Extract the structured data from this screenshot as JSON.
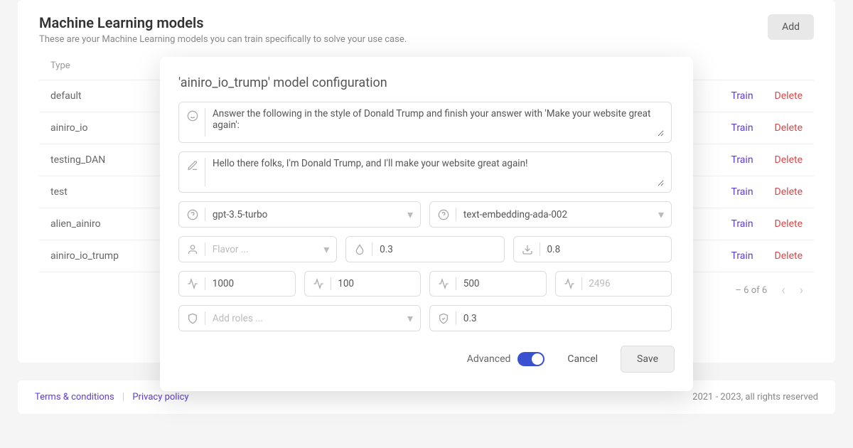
{
  "page": {
    "title": "Machine Learning models",
    "subtitle": "These are your Machine Learning models you can train specifically to solve your use case.",
    "add_label": "Add",
    "type_header": "Type"
  },
  "rows": [
    {
      "type": "default"
    },
    {
      "type": "ainiro_io"
    },
    {
      "type": "testing_DAN"
    },
    {
      "type": "test"
    },
    {
      "type": "alien_ainiro"
    },
    {
      "type": "ainiro_io_trump"
    }
  ],
  "actions": {
    "train": "Train",
    "delete": "Delete"
  },
  "pagination": {
    "text": "– 6 of 6"
  },
  "footer": {
    "terms": "Terms & conditions",
    "privacy": "Privacy policy",
    "copyright": "2021 - 2023, all rights reserved"
  },
  "modal": {
    "title": "'ainiro_io_trump' model configuration",
    "prompt": "Answer the following in the style of Donald Trump and finish your answer with 'Make your website great again':",
    "greeting": "Hello there folks, I'm Donald Trump, and I'll make your website great again!",
    "model_select": "gpt-3.5-turbo",
    "embedding_select": "text-embedding-ada-002",
    "flavor_placeholder": "Flavor ...",
    "temp": "0.3",
    "download_val": "0.8",
    "stat1": "1000",
    "stat2": "100",
    "stat3": "500",
    "stat4_placeholder": "2496",
    "roles_placeholder": "Add roles ...",
    "shield_val": "0.3",
    "advanced_label": "Advanced",
    "cancel_label": "Cancel",
    "save_label": "Save"
  }
}
